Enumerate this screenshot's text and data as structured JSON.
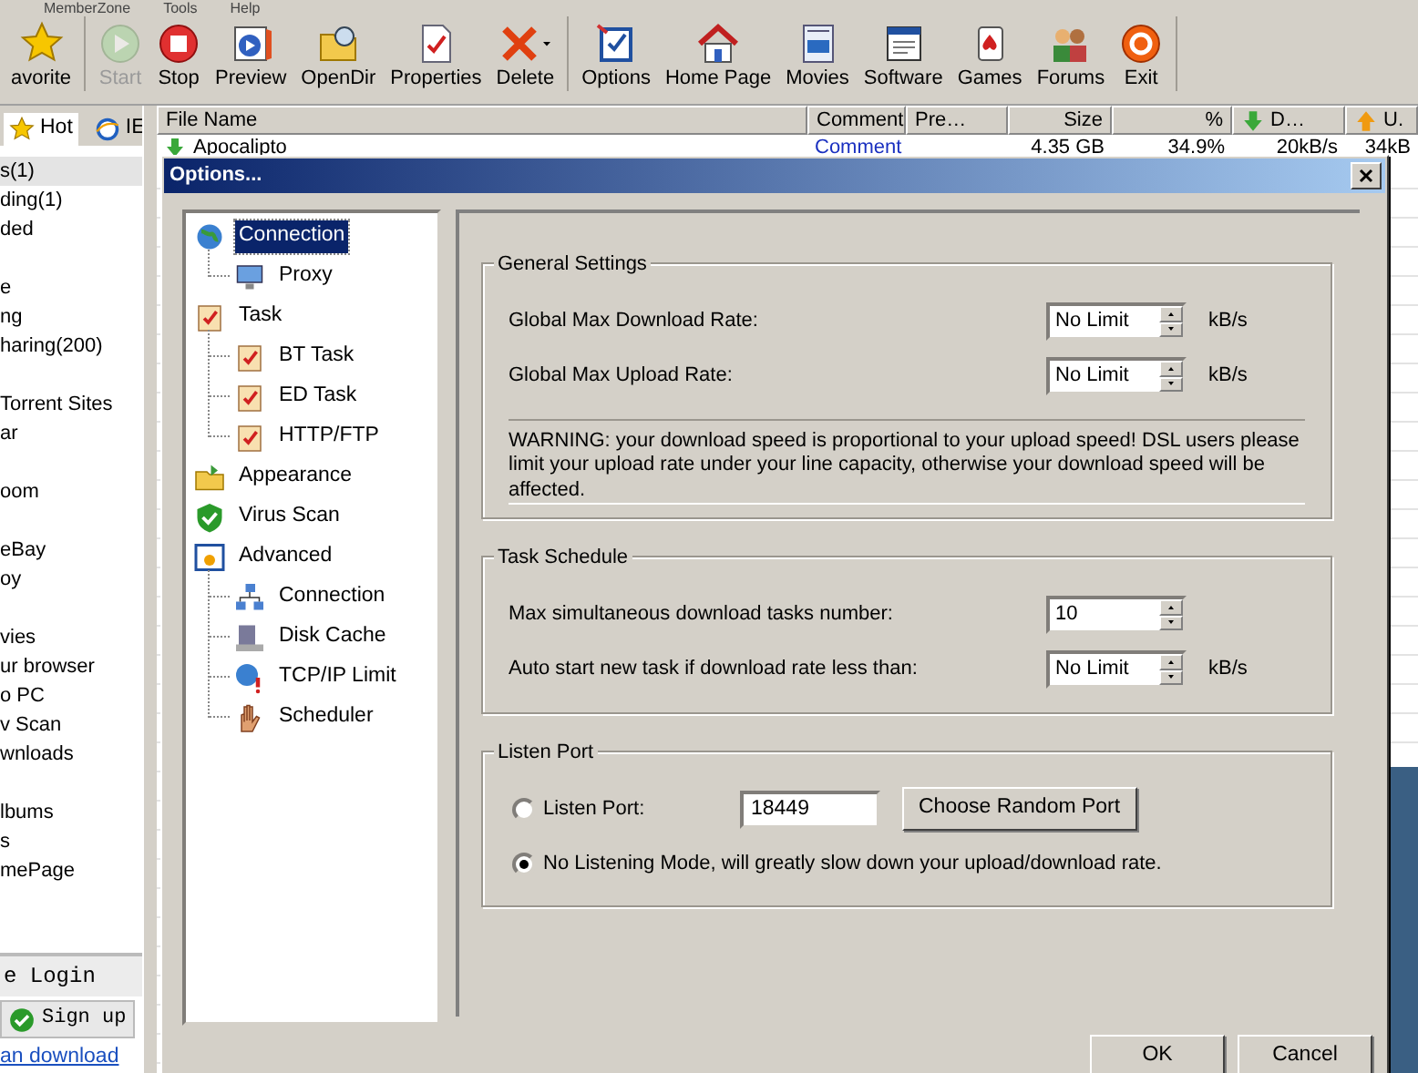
{
  "menu_bar": [
    {
      "label": "MemberZone"
    },
    {
      "label": "Tools"
    },
    {
      "label": "Help"
    }
  ],
  "toolbar": {
    "groups": [
      [
        {
          "label": "avorite",
          "kind": "button",
          "disabled": false
        }
      ],
      [
        {
          "label": "Start",
          "kind": "button",
          "disabled": true
        },
        {
          "label": "Stop",
          "kind": "button",
          "disabled": false
        },
        {
          "label": "Preview",
          "kind": "button",
          "disabled": false
        },
        {
          "label": "OpenDir",
          "kind": "button",
          "disabled": false
        },
        {
          "label": "Properties",
          "kind": "button",
          "disabled": false
        },
        {
          "label": "Delete",
          "kind": "split",
          "disabled": false
        }
      ],
      [
        {
          "label": "Options",
          "kind": "button",
          "disabled": false
        },
        {
          "label": "Home Page",
          "kind": "button",
          "disabled": false
        },
        {
          "label": "Movies",
          "kind": "button",
          "disabled": false
        },
        {
          "label": "Software",
          "kind": "button",
          "disabled": false
        },
        {
          "label": "Games",
          "kind": "button",
          "disabled": false
        },
        {
          "label": "Forums",
          "kind": "button",
          "disabled": false
        },
        {
          "label": "Exit",
          "kind": "button",
          "disabled": false
        }
      ]
    ]
  },
  "sidebar": {
    "tabs": [
      {
        "label": "Hot",
        "selected": true
      },
      {
        "label": "IE",
        "selected": false
      }
    ],
    "groups": [
      [
        {
          "label": "s(1)",
          "selected": true
        },
        {
          "label": "ding(1)",
          "selected": false
        },
        {
          "label": "ded",
          "selected": false
        }
      ],
      [
        {
          "label": "e",
          "selected": false
        },
        {
          "label": "ng",
          "selected": false
        },
        {
          "label": "haring(200)",
          "selected": false
        }
      ],
      [
        {
          "label": "Torrent Sites",
          "selected": false
        },
        {
          "label": "ar",
          "selected": false
        }
      ],
      [
        {
          "label": "oom",
          "selected": false
        }
      ],
      [
        {
          "label": "eBay",
          "selected": false
        },
        {
          "label": "oy",
          "selected": false
        }
      ],
      [
        {
          "label": "vies",
          "selected": false
        },
        {
          "label": "ur browser",
          "selected": false
        },
        {
          "label": "o PC",
          "selected": false
        },
        {
          "label": "v Scan",
          "selected": false
        },
        {
          "label": "wnloads",
          "selected": false
        }
      ],
      [
        {
          "label": "lbums",
          "selected": false
        },
        {
          "label": "s",
          "selected": false
        },
        {
          "label": "mePage",
          "selected": false
        }
      ]
    ],
    "login_title": "e Login",
    "signup_button": "Sign up",
    "download_link": "an download"
  },
  "table": {
    "columns": [
      "File Name",
      "Comment",
      "Pre…",
      "Size",
      "%",
      "D…",
      "U."
    ],
    "rows": [
      {
        "file_name": "Apocalipto",
        "comment": "Comment",
        "size": "4.35 GB",
        "percent": "34.9%",
        "down": "20kB/s",
        "up": "34kB"
      }
    ]
  },
  "dialog": {
    "title": "Options...",
    "tree": [
      {
        "label": "Connection",
        "selected": true,
        "children": [
          {
            "label": "Proxy",
            "selected": false
          }
        ]
      },
      {
        "label": "Task",
        "selected": false,
        "children": [
          {
            "label": "BT Task",
            "selected": false
          },
          {
            "label": "ED Task",
            "selected": false
          },
          {
            "label": "HTTP/FTP",
            "selected": false
          }
        ]
      },
      {
        "label": "Appearance",
        "selected": false
      },
      {
        "label": "Virus Scan",
        "selected": false
      },
      {
        "label": "Advanced",
        "selected": false,
        "children": [
          {
            "label": "Connection",
            "selected": false
          },
          {
            "label": "Disk Cache",
            "selected": false
          },
          {
            "label": "TCP/IP Limit",
            "selected": false
          },
          {
            "label": "Scheduler",
            "selected": false
          }
        ]
      }
    ],
    "sections": [
      {
        "title": "General Settings",
        "rows": [
          {
            "kind": "spin",
            "label": "Global Max Download Rate:",
            "value": "No Limit",
            "unit": "kB/s"
          },
          {
            "kind": "spin",
            "label": "Global Max Upload Rate:",
            "value": "No Limit",
            "unit": "kB/s"
          },
          {
            "kind": "warning",
            "text": "WARNING: your download speed is proportional to your upload speed! DSL users please limit your upload rate under your line capacity, otherwise your download speed will be affected."
          }
        ]
      },
      {
        "title": "Task Schedule",
        "rows": [
          {
            "kind": "spin",
            "label": "Max simultaneous download tasks number:",
            "value": "10"
          },
          {
            "kind": "spin",
            "label": "Auto start new task if download rate less than:",
            "value": "No Limit",
            "unit": "kB/s"
          }
        ]
      },
      {
        "title": "Listen Port",
        "rows": [
          {
            "kind": "radio",
            "label": "Listen Port:",
            "selected": false,
            "value": "18449",
            "button": "Choose Random Port"
          },
          {
            "kind": "radio",
            "label": "No Listening Mode, will greatly slow down your upload/download rate.",
            "selected": true
          }
        ]
      }
    ],
    "buttons": [
      "OK",
      "Cancel"
    ]
  }
}
